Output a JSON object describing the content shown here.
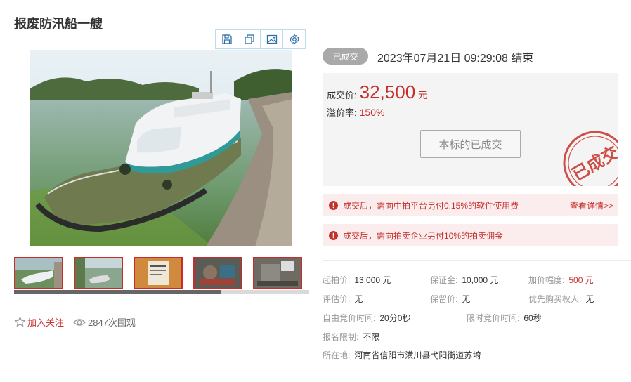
{
  "title": "报废防汛船一艘",
  "toolbar": {
    "buttons": [
      {
        "icon": "save-icon"
      },
      {
        "icon": "copy-icon"
      },
      {
        "icon": "image-icon"
      },
      {
        "icon": "settings-icon"
      }
    ]
  },
  "gallery": {
    "thumbnail_count": 5,
    "selected_index": 0
  },
  "actions": {
    "follow_label": "加入关注",
    "views_text": "2847次围观"
  },
  "status": {
    "badge": "已成交",
    "end_time": "2023年07月21日  09:29:08 结束"
  },
  "price": {
    "deal_label": "成交价:",
    "deal_value": "32,500",
    "deal_unit": "元",
    "premium_label": "溢价率:",
    "premium_value": "150%",
    "button_label": "本标的已成交",
    "stamp_text": "已成交"
  },
  "notices": [
    {
      "text": "成交后，需向中拍平台另付0.15%的软件使用费",
      "link": "查看详情>>"
    },
    {
      "text": "成交后，需向拍卖企业另付10%的拍卖佣金"
    }
  ],
  "info": {
    "start_price": {
      "label": "起拍价:",
      "value": "13,000 元"
    },
    "deposit": {
      "label": "保证金:",
      "value": "10,000 元"
    },
    "increment": {
      "label": "加价幅度:",
      "value": "500 元"
    },
    "appraisal": {
      "label": "评估价:",
      "value": "无"
    },
    "reserve": {
      "label": "保留价:",
      "value": "无"
    },
    "priority": {
      "label": "优先购买权人:",
      "value": "无"
    },
    "free_bid_time": {
      "label": "自由竞价时间:",
      "value": "20分0秒"
    },
    "limited_bid_time": {
      "label": "限时竞价时间:",
      "value": "60秒"
    },
    "restriction": {
      "label": "报名限制:",
      "value": "不限"
    },
    "location": {
      "label": "所在地:",
      "value": "河南省信阳市潢川县弋阳街道苏埼"
    }
  },
  "colors": {
    "accent_red": "#c4302b",
    "badge_gray": "#a9a9a9",
    "notice_bg": "#fbeced",
    "toolbar_border": "#b9dcef"
  }
}
